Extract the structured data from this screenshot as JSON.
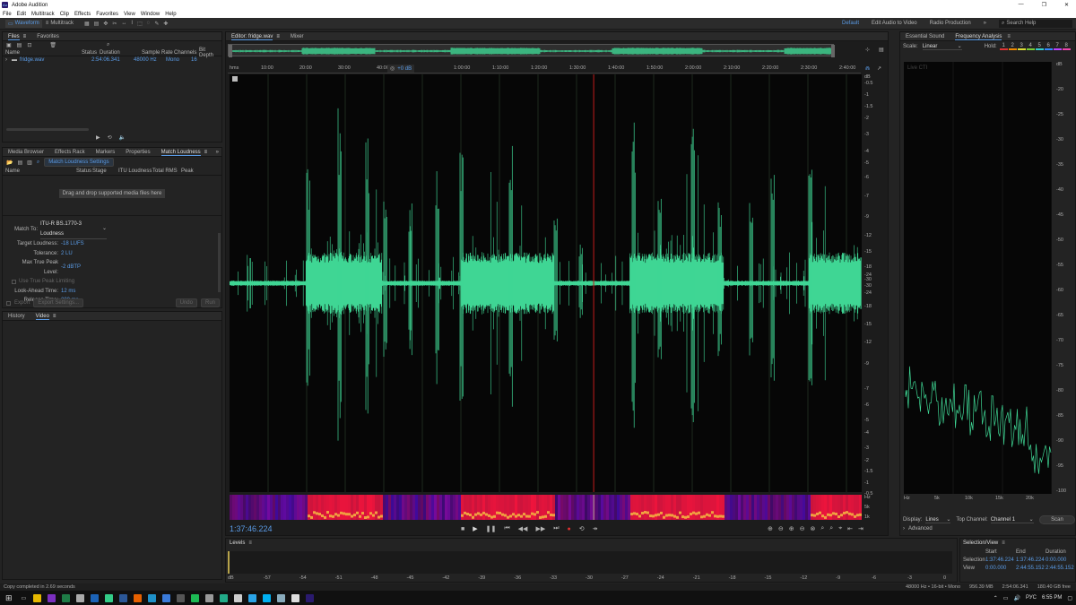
{
  "app": {
    "title": "Adobe Audition"
  },
  "menu": [
    "File",
    "Edit",
    "Multitrack",
    "Clip",
    "Effects",
    "Favorites",
    "View",
    "Window",
    "Help"
  ],
  "toolbar": {
    "waveform_label": "Waveform",
    "multitrack_label": "Multitrack",
    "workspaces": [
      "Default",
      "Edit Audio to Video",
      "Radio Production"
    ],
    "search_placeholder": "Search Help"
  },
  "files_panel": {
    "tabs": [
      "Files",
      "Favorites"
    ],
    "columns": [
      "Name",
      "Status",
      "Duration",
      "Sample Rate",
      "Channels",
      "Bit Depth"
    ],
    "rows": [
      {
        "name": "fridge.wav",
        "status": "",
        "duration": "2:54:06.341",
        "rate": "48000 Hz",
        "channels": "Mono",
        "bits": "16"
      }
    ]
  },
  "loudness_panel": {
    "tabs": [
      "Media Browser",
      "Effects Rack",
      "Markers",
      "Properties",
      "Match Loudness"
    ],
    "settings_button": "Match Loudness Settings",
    "columns": [
      "Name",
      "Status",
      "Stage",
      "ITU Loudness",
      "Total RMS",
      "Peak"
    ],
    "drop_hint": "Drag and drop supported media files here",
    "match_to_label": "Match To:",
    "match_to_value": "ITU-R BS.1770-3 Loudness",
    "target_label": "Target Loudness:",
    "target_value": "-18 LUFS",
    "tolerance_label": "Tolerance:",
    "tolerance_value": "2 LU",
    "max_peak_label": "Max True Peak Level:",
    "max_peak_value": "-2 dBTP",
    "limiting_label": "Use True Peak Limiting",
    "lookahead_label": "Look-Ahead Time:",
    "lookahead_value": "12 ms",
    "release_label": "Release Time:",
    "release_value": "200 ms",
    "export_label": "Export",
    "export_settings": "Export Settings...",
    "undo": "Undo",
    "run": "Run"
  },
  "history_panel": {
    "tabs": [
      "History",
      "Video"
    ]
  },
  "editor": {
    "tabs": [
      "Editor: fridge.wav",
      "Mixer"
    ],
    "time_ruler_unit": "hms",
    "time_ticks": [
      "10:00",
      "20:00",
      "30:00",
      "40:00",
      "1:00:00",
      "1:10:00",
      "1:20:00",
      "1:30:00",
      "1:40:00",
      "1:50:00",
      "2:00:00",
      "2:10:00",
      "2:20:00",
      "2:30:00",
      "2:40:00"
    ],
    "db_ticks": [
      "dB",
      "-0.5",
      "-1",
      "-1.5",
      "-2",
      "-3",
      "-4",
      "-5",
      "-6",
      "-7",
      "-9",
      "-12",
      "-15",
      "-18",
      "-24",
      "-30",
      "-30",
      "-24",
      "-18",
      "-15",
      "-12",
      "-9",
      "-7",
      "-6",
      "-5",
      "-4",
      "-3",
      "-2",
      "-1.5",
      "-1",
      "-0.5"
    ],
    "hud_gain": "+0 dB",
    "spec_labels": [
      "Hz",
      "5k",
      "1k"
    ],
    "current_time": "1:37:46.224",
    "playhead_fraction": 0.576,
    "waveform_color": "#3fd694",
    "playhead_color": "#c21a1a"
  },
  "levels": {
    "title": "Levels",
    "ticks": [
      "dB",
      "-57",
      "-54",
      "-51",
      "-48",
      "-45",
      "-42",
      "-39",
      "-36",
      "-33",
      "-30",
      "-27",
      "-24",
      "-21",
      "-18",
      "-15",
      "-12",
      "-9",
      "-6",
      "-3",
      "0"
    ]
  },
  "essential_sound": {
    "title": "Essential Sound"
  },
  "frequency": {
    "title": "Frequency Analysis",
    "scale_label": "Scale:",
    "scale_value": "Linear",
    "hold_label": "Hold:",
    "hold_buttons": [
      "1",
      "2",
      "3",
      "4",
      "5",
      "6",
      "7",
      "8"
    ],
    "hold_colors": [
      "#d33",
      "#e80",
      "#dd3",
      "#7c3",
      "#3cc",
      "#38f",
      "#b4f",
      "#e4a"
    ],
    "live_label": "Live CTI",
    "y_ticks": [
      "dB",
      "-20",
      "-25",
      "-30",
      "-35",
      "-40",
      "-45",
      "-50",
      "-55",
      "-60",
      "-65",
      "-70",
      "-75",
      "-80",
      "-85",
      "-90",
      "-95",
      "-100"
    ],
    "x_ticks": [
      "Hz",
      "5k",
      "10k",
      "15k",
      "20k"
    ],
    "display_label": "Display:",
    "display_value": "Lines",
    "top_channel_label": "Top Channel:",
    "top_channel_value": "Channel 1",
    "scan_button": "Scan",
    "advanced_label": "Advanced"
  },
  "selection_view": {
    "title": "Selection/View",
    "headers": [
      "Start",
      "End",
      "Duration"
    ],
    "rows": [
      {
        "label": "Selection",
        "start": "1:37:46.224",
        "end": "1:37:46.224",
        "duration": "0:00.000"
      },
      {
        "label": "View",
        "start": "0:00.000",
        "end": "2:44:55.152",
        "duration": "2:44:55.152"
      }
    ]
  },
  "status": {
    "left": "Copy completed in 2.69 seconds",
    "format": "48000 Hz • 16-bit • Mono",
    "size": "956.39 MB",
    "duration": "2:54:06.341",
    "free": "180.40 GB free"
  },
  "taskbar": {
    "lang": "РУС",
    "time": "6:55 PM"
  }
}
